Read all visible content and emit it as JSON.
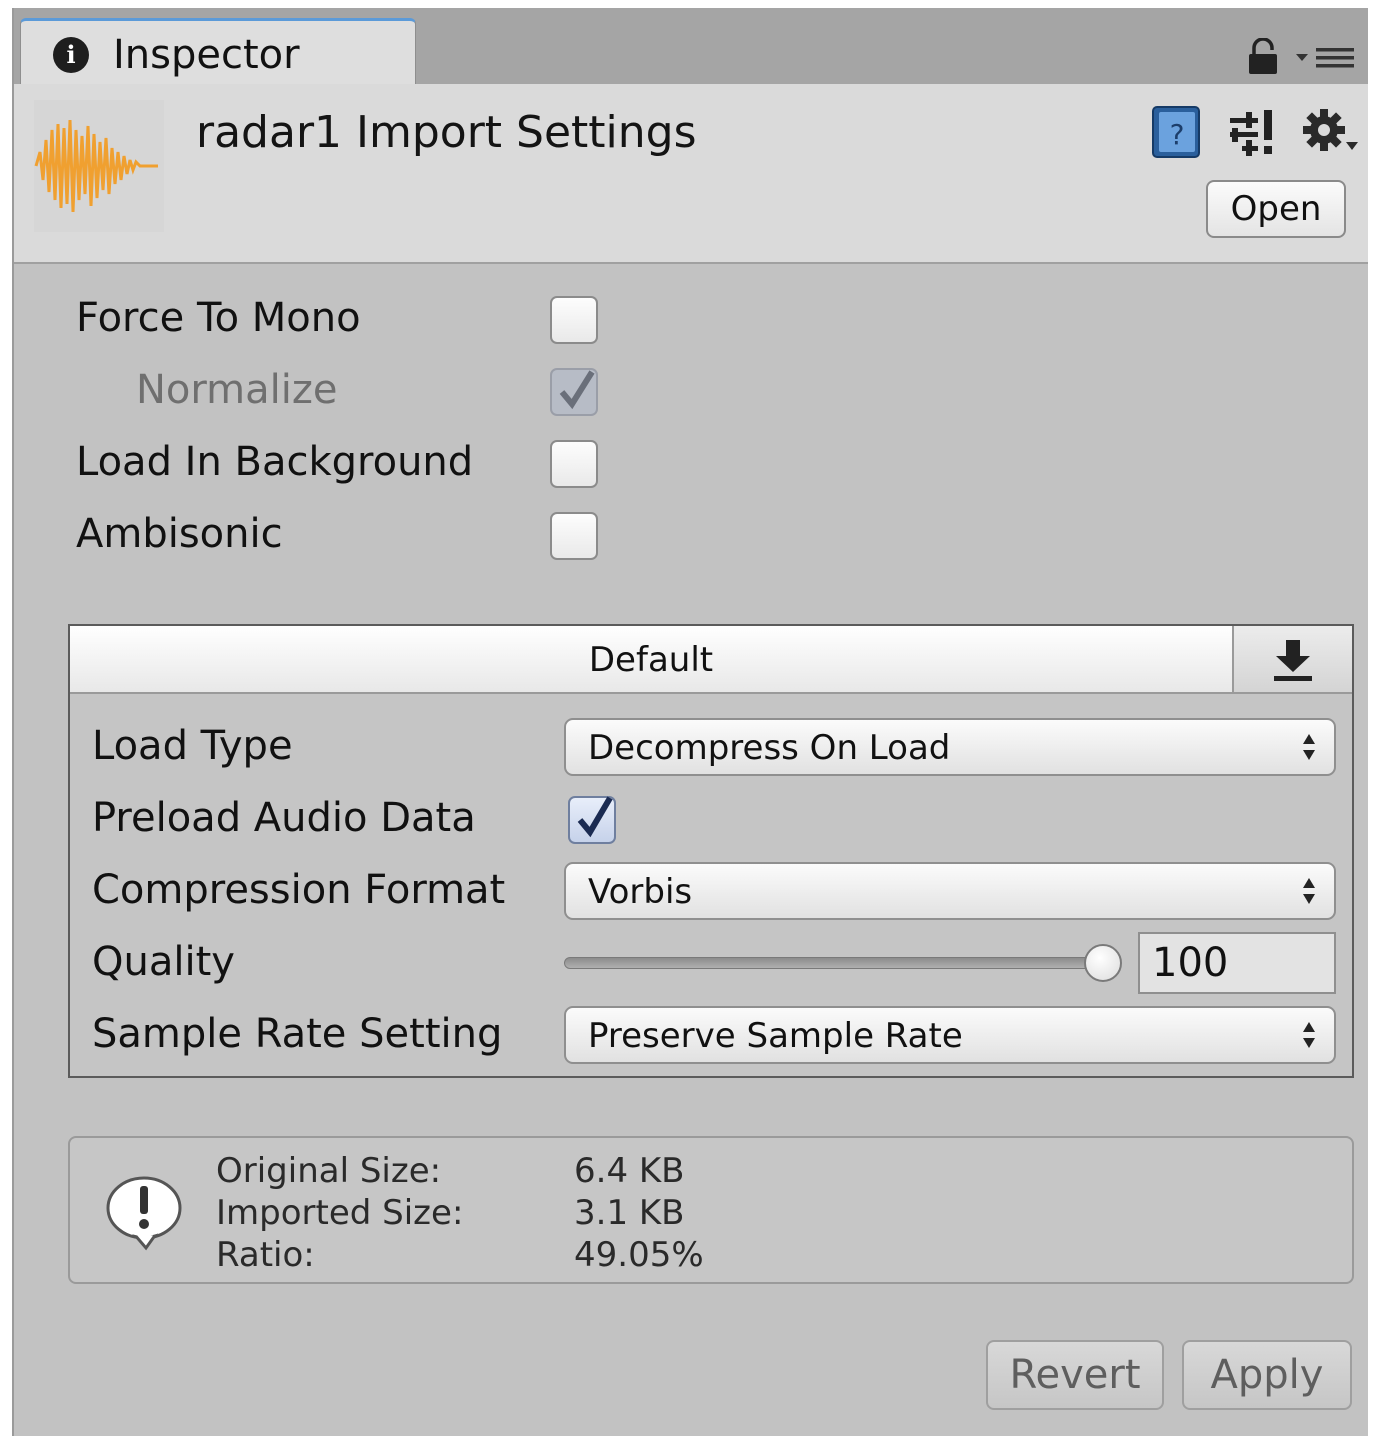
{
  "tab": {
    "label": "Inspector",
    "icon": "info-icon"
  },
  "header": {
    "title": "radar1 Import Settings",
    "open_label": "Open",
    "icons": [
      "audio-waveform-icon",
      "help-book-icon",
      "preset-sliders-icon",
      "gear-icon"
    ]
  },
  "properties": {
    "force_to_mono": {
      "label": "Force To Mono",
      "checked": false
    },
    "normalize": {
      "label": "Normalize",
      "checked": true,
      "disabled": true
    },
    "load_in_background": {
      "label": "Load In Background",
      "checked": false
    },
    "ambisonic": {
      "label": "Ambisonic",
      "checked": false
    }
  },
  "platform": {
    "title": "Default",
    "load_type": {
      "label": "Load Type",
      "value": "Decompress On Load"
    },
    "preload_audio_data": {
      "label": "Preload Audio Data",
      "checked": true
    },
    "compression_format": {
      "label": "Compression Format",
      "value": "Vorbis"
    },
    "quality": {
      "label": "Quality",
      "value": "100",
      "slider_fraction": 1.0
    },
    "sample_rate_setting": {
      "label": "Sample Rate Setting",
      "value": "Preserve Sample Rate"
    }
  },
  "info": {
    "original_size_label": "Original Size:",
    "original_size_value": "6.4 KB",
    "imported_size_label": "Imported Size:",
    "imported_size_value": "3.1 KB",
    "ratio_label": "Ratio:",
    "ratio_value": "49.05%"
  },
  "buttons": {
    "revert_label": "Revert",
    "apply_label": "Apply"
  },
  "colors": {
    "accent_tab": "#5b9ad8",
    "waveform": "#f0a030",
    "checkbox_check": "#1b2b52"
  }
}
